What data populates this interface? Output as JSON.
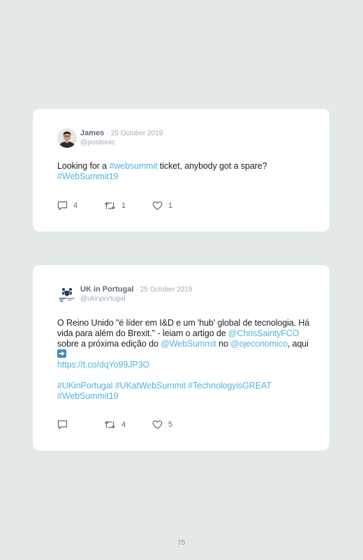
{
  "tweets": [
    {
      "name": "James",
      "separator": "·",
      "date": "25 October 2019",
      "handle": "@positonic",
      "text": {
        "part1": "Looking for a ",
        "hashtag1": "#websummit",
        "part2": " ticket, anybody got a spare?",
        "hashtag2": "#WebSummit19"
      },
      "reply_count": "4",
      "retweet_count": "1",
      "like_count": "1"
    },
    {
      "name": "UK in Portugal",
      "separator": "·",
      "date": "25 October 2019",
      "handle": "@ukinportugal",
      "text": {
        "part1": "O Reino Unido \"é líder em I&D e um 'hub' global de tecnologia. Há vida para além do Brexit.\" - leiam o artigo de ",
        "mention1": "@ChrisSaintyFCO",
        "part2": " sobre a próxima edição do ",
        "mention2": "@WebSummit",
        "part3": " no ",
        "mention3": "@ojeconomico",
        "part4": ", aqui",
        "url": "https://t.co/dqYo99JP3O",
        "hashtag1": "#UKinPortugal",
        "hashtag2": "#UKatWebSummit",
        "hashtag3": "#TechnologyisGREAT",
        "hashtag4": "#WebSummit19"
      },
      "reply_count": "",
      "retweet_count": "4",
      "like_count": "5"
    }
  ],
  "icons": {
    "reply": "comment-icon",
    "retweet": "retweet-icon",
    "like": "heart-icon",
    "emoji": "right-arrow-emoji-icon"
  },
  "colors": {
    "link": "#4fb5e0",
    "background": "#e3eae6",
    "name": "#5e6b79",
    "meta": "#a3acb5"
  },
  "page_number": "75"
}
